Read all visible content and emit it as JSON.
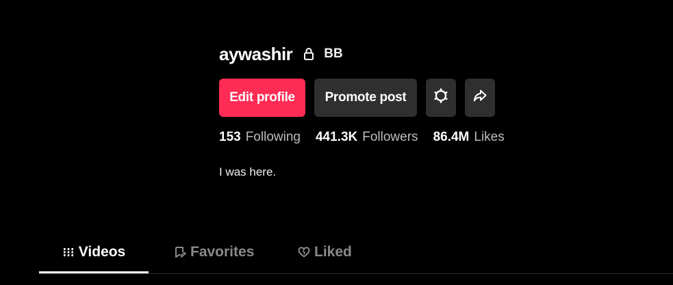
{
  "profile": {
    "username": "aywashir",
    "nickname": "BB",
    "bio": "I was here."
  },
  "actions": {
    "edit_profile": "Edit profile",
    "promote_post": "Promote post",
    "settings_icon": "gear-icon",
    "share_icon": "share-icon"
  },
  "stats": [
    {
      "value": "153",
      "label": "Following"
    },
    {
      "value": "441.3K",
      "label": "Followers"
    },
    {
      "value": "86.4M",
      "label": "Likes"
    }
  ],
  "tabs": [
    {
      "label": "Videos",
      "icon": "grid-icon",
      "active": true
    },
    {
      "label": "Favorites",
      "icon": "bookmark-icon",
      "active": false
    },
    {
      "label": "Liked",
      "icon": "heart-icon",
      "active": false
    }
  ],
  "colors": {
    "background": "#000000",
    "primary": "#fe2c55",
    "secondary_button": "#2f2f2f"
  }
}
